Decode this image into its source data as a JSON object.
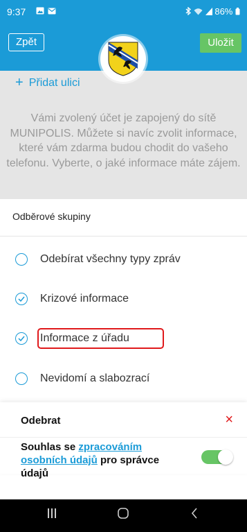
{
  "status_bar": {
    "time": "9:37",
    "battery": "86%"
  },
  "header": {
    "back_label": "Zpět",
    "save_label": "Uložit"
  },
  "add_street": {
    "plus": "+",
    "label": "Přidat ulici"
  },
  "info_text": "Vámi zvolený účet je zapojený do sítě MUNIPOLIS. Můžete si navíc zvolit informace, které vám zdarma budou chodit do vašeho telefonu. Vyberte, o jaké informace máte zájem.",
  "section_title": "Odběrové skupiny",
  "options": [
    {
      "label": "Odebírat všechny typy zpráv",
      "checked": false
    },
    {
      "label": "Krizové informace",
      "checked": true
    },
    {
      "label": "Informace z úřadu",
      "checked": true
    },
    {
      "label": "Nevidomí a slabozrací",
      "checked": false
    }
  ],
  "footer": {
    "unsubscribe_label": "Odebrat",
    "close_symbol": "×",
    "consent_prefix": "Souhlas se ",
    "consent_link": "zpracováním osobních údajů",
    "consent_suffix": " pro správce údajů",
    "consent_enabled": true
  },
  "colors": {
    "accent": "#1b9bd7",
    "save_green": "#67c565",
    "highlight_red": "#e0191b"
  },
  "icons": {
    "status_left": [
      "gallery-icon",
      "mail-icon"
    ],
    "status_right": [
      "bluetooth-icon",
      "wifi-icon",
      "signal-icon",
      "battery-icon"
    ],
    "nav": [
      "recents-icon",
      "home-icon",
      "back-icon"
    ]
  }
}
